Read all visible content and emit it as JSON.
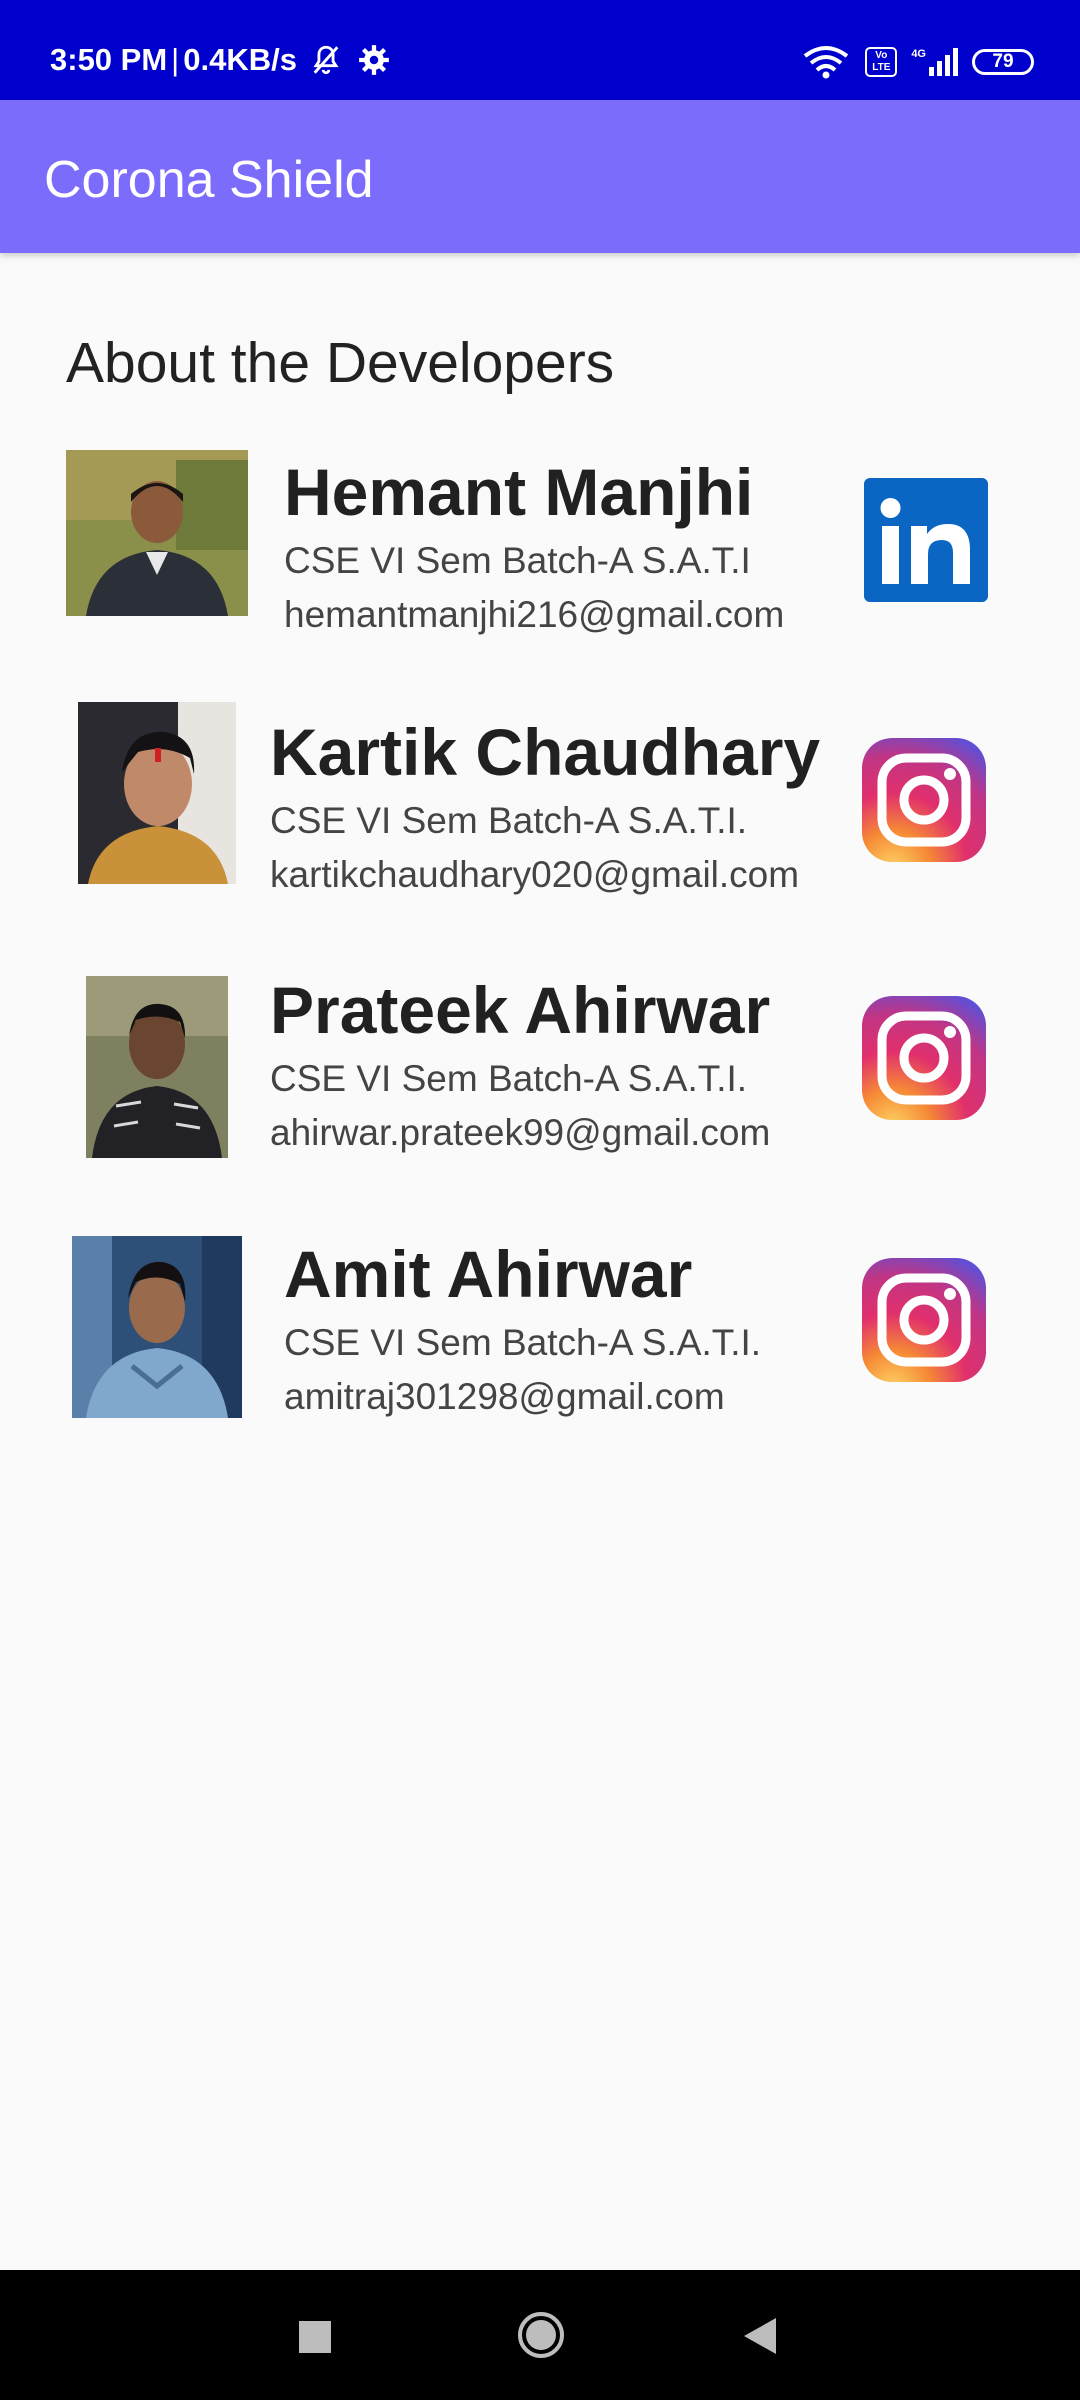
{
  "status_bar": {
    "time": "3:50 PM",
    "separator": "|",
    "speed": "0.4KB/s",
    "volte_label_1": "Vo",
    "volte_label_2": "LTE",
    "network_label": "4G",
    "battery": "79"
  },
  "app_bar": {
    "title": "Corona Shield"
  },
  "page": {
    "section_title": "About the Developers"
  },
  "developers": [
    {
      "name": "Hemant Manjhi",
      "subtitle": "CSE VI Sem Batch-A  S.A.T.I",
      "email": "hemantmanjhi216@gmail.com",
      "social_icon": "linkedin-icon"
    },
    {
      "name": "Kartik Chaudhary",
      "subtitle": "CSE VI Sem Batch-A  S.A.T.I.",
      "email": "kartikchaudhary020@gmail.com",
      "social_icon": "instagram-icon"
    },
    {
      "name": "Prateek Ahirwar",
      "subtitle": "CSE VI Sem Batch-A  S.A.T.I.",
      "email": "ahirwar.prateek99@gmail.com",
      "social_icon": "instagram-icon"
    },
    {
      "name": "Amit Ahirwar",
      "subtitle": "CSE VI Sem Batch-A  S.A.T.I.",
      "email": "amitraj301298@gmail.com",
      "social_icon": "instagram-icon"
    }
  ],
  "colors": {
    "status_bar": "#0000cc",
    "app_bar": "#7c6cfc",
    "background": "#fafafa",
    "linkedin_blue": "#0a66c2"
  },
  "nav_bar": {
    "buttons": [
      "recents-icon",
      "home-icon",
      "back-icon"
    ]
  }
}
